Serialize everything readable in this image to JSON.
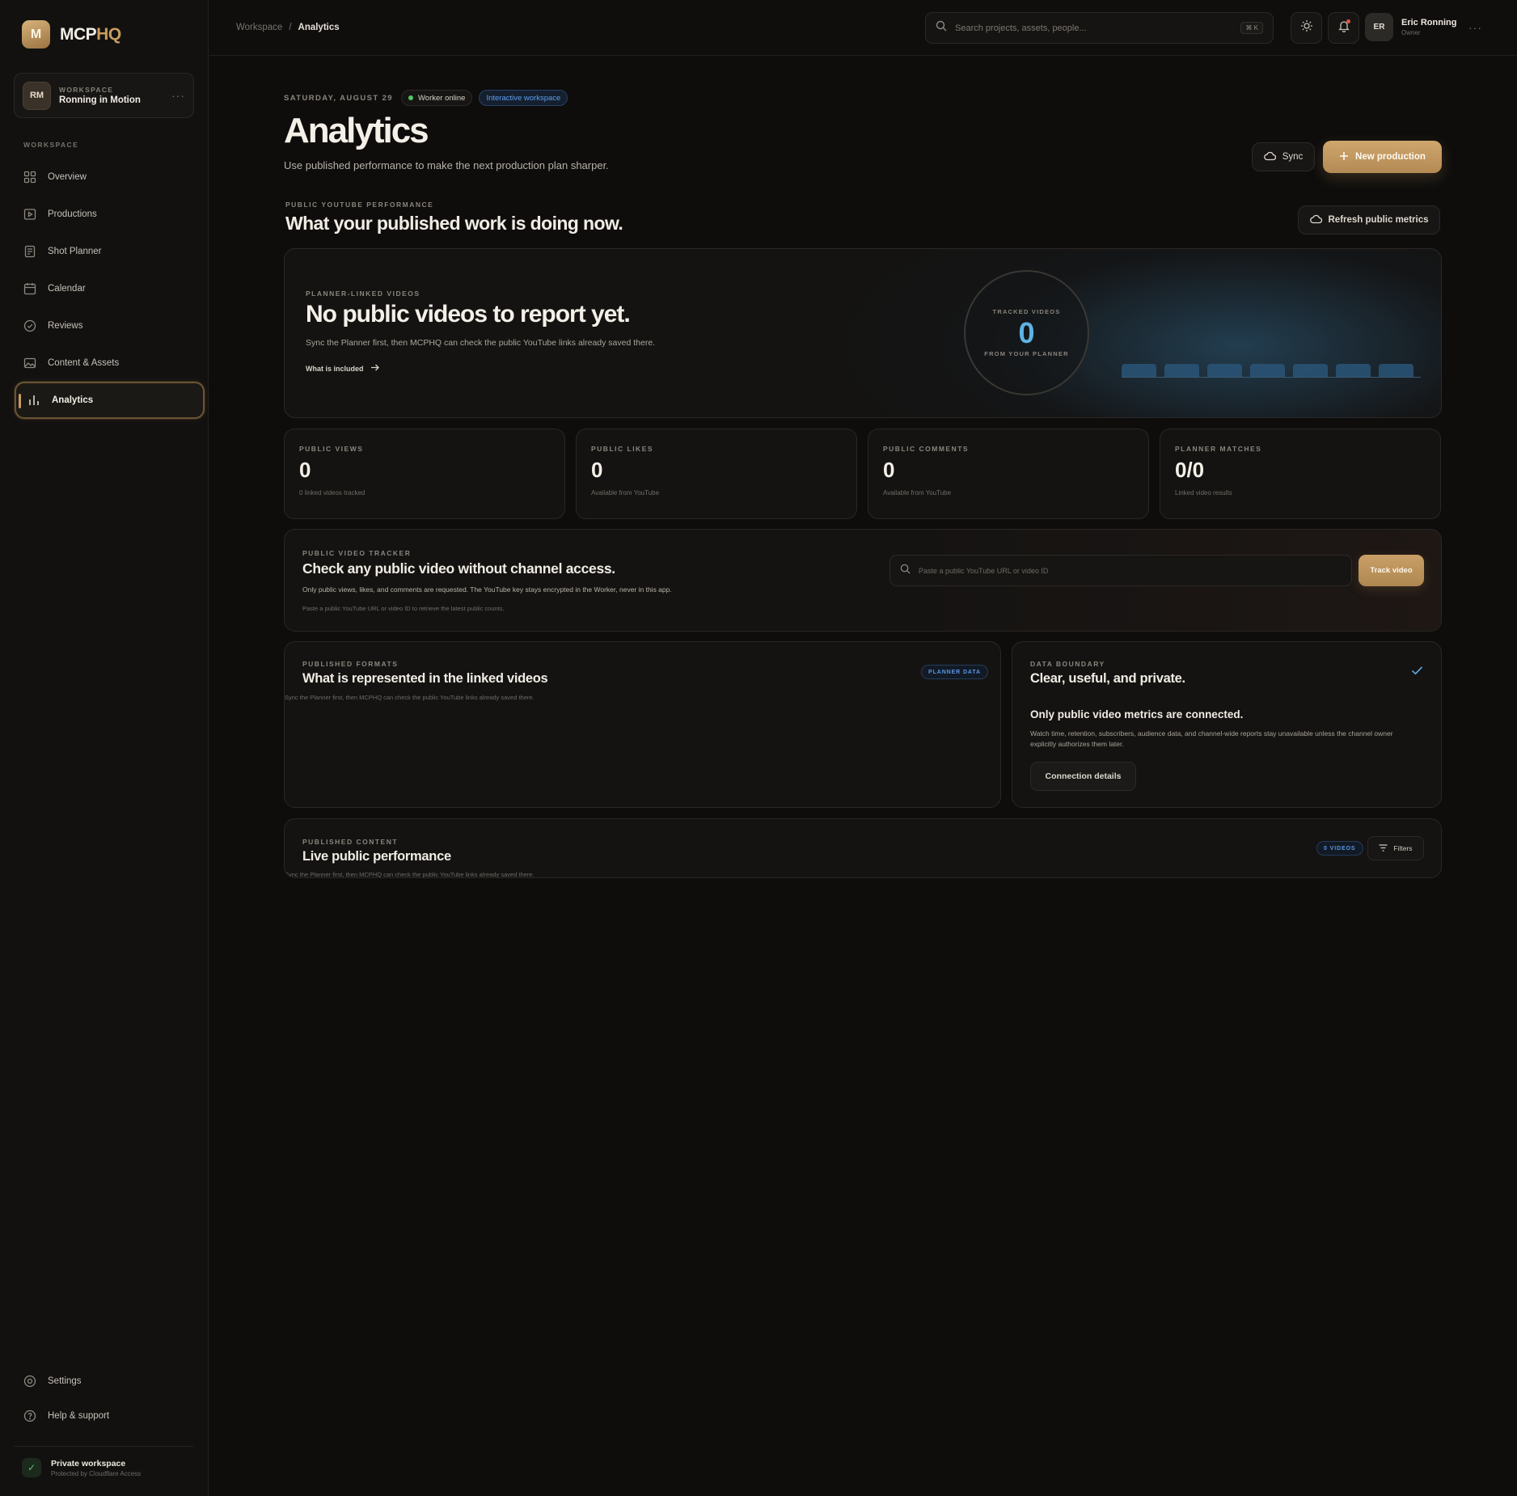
{
  "brand": {
    "mark": "M",
    "name_main": "MCP",
    "name_accent": "HQ"
  },
  "workspace_card": {
    "avatar": "RM",
    "eyebrow": "WORKSPACE",
    "name": "Ronning in Motion",
    "more": "···"
  },
  "sidebar": {
    "section_label": "WORKSPACE",
    "items": [
      {
        "label": "Overview",
        "icon": "grid-icon"
      },
      {
        "label": "Productions",
        "icon": "play-icon"
      },
      {
        "label": "Shot Planner",
        "icon": "clipboard-icon"
      },
      {
        "label": "Calendar",
        "icon": "calendar-icon"
      },
      {
        "label": "Reviews",
        "icon": "review-check-icon"
      },
      {
        "label": "Content & Assets",
        "icon": "image-icon"
      },
      {
        "label": "Analytics",
        "icon": "bar-chart-icon",
        "active": true
      }
    ],
    "bottom_items": [
      {
        "label": "Settings",
        "icon": "gear-icon"
      },
      {
        "label": "Help & support",
        "icon": "help-icon"
      }
    ],
    "footer": {
      "title": "Private workspace",
      "subtitle": "Protected by Cloudflare Access"
    }
  },
  "topbar": {
    "breadcrumb": [
      "Workspace",
      "/",
      "Analytics"
    ],
    "search_placeholder": "Search projects, assets, people...",
    "shortcut": "⌘ K",
    "user": {
      "initials": "ER",
      "name": "Eric Ronning",
      "role": "Owner"
    },
    "more": "···"
  },
  "header": {
    "date": "SATURDAY, AUGUST 29",
    "worker_status": "Worker online",
    "mode_badge": "Interactive workspace",
    "title": "Analytics",
    "subtitle": "Use published performance to make the next production plan sharper.",
    "sync_label": "Sync",
    "new_production_label": "New production"
  },
  "performance": {
    "eyebrow": "PUBLIC YOUTUBE PERFORMANCE",
    "title": "What your published work is doing now.",
    "refresh_label": "Refresh public metrics"
  },
  "hero": {
    "eyebrow": "PLANNER-LINKED VIDEOS",
    "title": "No public videos to report yet.",
    "description": "Sync the Planner first, then MCPHQ can check the public YouTube links already saved there.",
    "link": "What is included",
    "ring_top": "TRACKED VIDEOS",
    "ring_value": "0",
    "ring_bottom": "FROM YOUR PLANNER"
  },
  "stats": [
    {
      "label": "PUBLIC VIEWS",
      "value": "0",
      "note": "0 linked videos tracked"
    },
    {
      "label": "PUBLIC LIKES",
      "value": "0",
      "note": "Available from YouTube"
    },
    {
      "label": "PUBLIC COMMENTS",
      "value": "0",
      "note": "Available from YouTube"
    },
    {
      "label": "PLANNER MATCHES",
      "value": "0/0",
      "note": "Linked video results"
    }
  ],
  "tracker": {
    "eyebrow": "PUBLIC VIDEO TRACKER",
    "title": "Check any public video without channel access.",
    "description": "Only public views, likes, and comments are requested. The YouTube key stays encrypted in the Worker, never in this app.",
    "hint": "Paste a public YouTube URL or video ID to retrieve the latest public counts.",
    "input_placeholder": "Paste a public YouTube URL or video ID",
    "button": "Track video"
  },
  "formats": {
    "eyebrow": "PUBLISHED FORMATS",
    "title": "What is represented in the linked videos",
    "badge": "PLANNER DATA",
    "empty": "Sync the Planner first, then MCPHQ can check the public YouTube links already saved there."
  },
  "boundary": {
    "eyebrow": "DATA BOUNDARY",
    "title": "Clear, useful, and private.",
    "heading": "Only public video metrics are connected.",
    "body": "Watch time, retention, subscribers, audience data, and channel-wide reports stay unavailable unless the channel owner explicitly authorizes them later.",
    "button": "Connection details"
  },
  "live": {
    "eyebrow": "PUBLISHED CONTENT",
    "title": "Live public performance",
    "badge": "0 VIDEOS",
    "filters": "Filters",
    "empty": "Sync the Planner first, then MCPHQ can check the public YouTube links already saved there."
  },
  "colors": {
    "accent": "#c89c5e",
    "online": "#4dc765",
    "info_blue": "#5fb3e4",
    "background": "#0e0d0c"
  }
}
